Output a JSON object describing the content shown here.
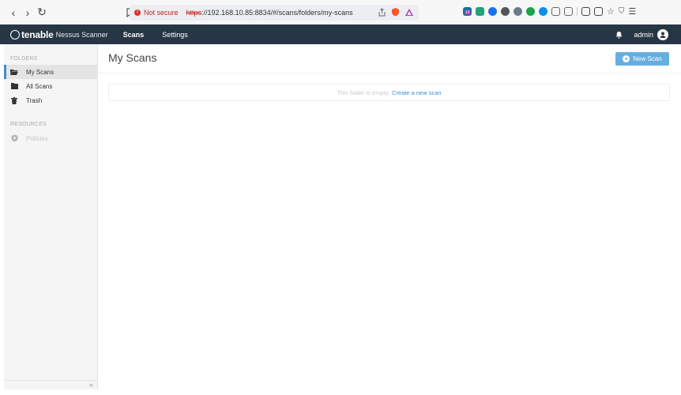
{
  "browser": {
    "nav": {
      "back_glyph": "‹",
      "forward_glyph": "›",
      "reload_glyph": "↻"
    },
    "omnibox": {
      "warning_label": "Not secure",
      "url_protocol": "https",
      "url_rest": "://192.168.10.85:8834/#/scans/folders/my-scans"
    },
    "extensions": [
      "house-icon",
      "camera-icon",
      "circle-icon",
      "gear-icon",
      "face-icon",
      "reload-icon",
      "play-icon",
      "puzzle-icon",
      "window-icon",
      "sidebar-icon",
      "split-icon",
      "star-icon",
      "shield-icon",
      "menu-icon"
    ],
    "extension_badge": "10"
  },
  "app": {
    "brand": "tenable",
    "product": "Nessus Scanner",
    "nav": [
      {
        "label": "Scans",
        "active": true
      },
      {
        "label": "Settings",
        "active": false
      }
    ],
    "user": "admin",
    "colors": {
      "header_bg": "#273645",
      "accent": "#3e8ed0",
      "button": "#67aee0"
    }
  },
  "sidebar": {
    "folders_heading": "FOLDERS",
    "folders": [
      {
        "label": "My Scans",
        "icon": "folder-open-icon",
        "active": true
      },
      {
        "label": "All Scans",
        "icon": "folder-icon",
        "active": false
      },
      {
        "label": "Trash",
        "icon": "trash-icon",
        "active": false
      }
    ],
    "resources_heading": "RESOURCES",
    "resources": [
      {
        "label": "Policies",
        "icon": "policy-shield-icon",
        "disabled": true
      }
    ],
    "collapse_glyph": "«"
  },
  "main": {
    "title": "My Scans",
    "new_scan_label": "New Scan",
    "empty_text": "This folder is empty.",
    "empty_link": "Create a new scan"
  }
}
